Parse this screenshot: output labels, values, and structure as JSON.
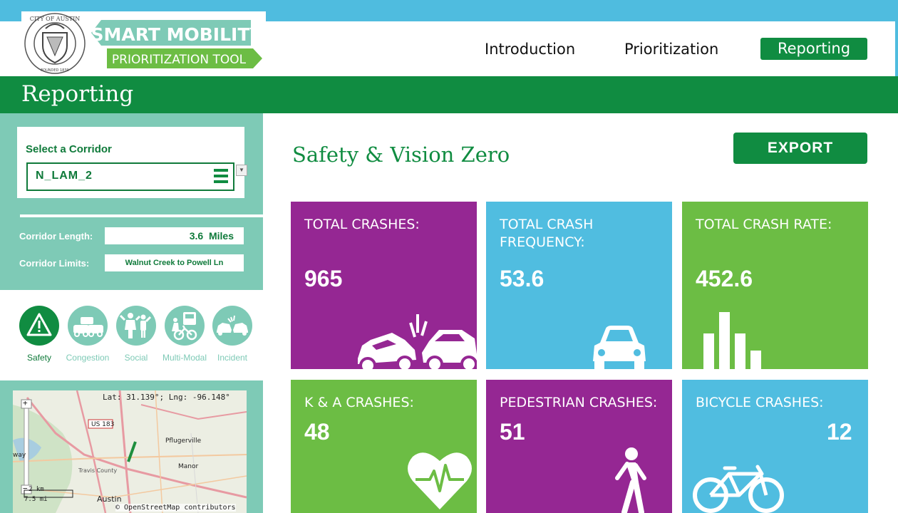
{
  "colors": {
    "brand_green": "#108c41",
    "mint": "#7ecab6",
    "purple": "#952793",
    "blue": "#50bde0",
    "lime": "#6cbd44",
    "top_blue": "#4fbcdf"
  },
  "logo": {
    "seal_text": "CITY OF AUSTIN",
    "seal_founded": "FOUNDED 1839",
    "line1": "SMART MOBILITY",
    "line2": "PRIORITIZATION TOOL"
  },
  "nav": {
    "items": [
      "Introduction",
      "Prioritization",
      "Reporting"
    ],
    "active": "Reporting"
  },
  "page": {
    "title": "Reporting"
  },
  "sidebar": {
    "select_label": "Select a Corridor",
    "selected_corridor": "N_LAM_2",
    "length_label": "Corridor Length:",
    "length_value": "3.6",
    "length_unit": "Miles",
    "limits_label": "Corridor Limits:",
    "limits_value": "Walnut Creek to Powell Ln",
    "categories": [
      {
        "label": "Safety",
        "icon": "warning-icon",
        "active": true
      },
      {
        "label": "Congestion",
        "icon": "traffic-cars-icon",
        "active": false
      },
      {
        "label": "Social",
        "icon": "people-icon",
        "active": false
      },
      {
        "label": "Multi-Modal",
        "icon": "bus-bike-icon",
        "active": false
      },
      {
        "label": "Incident",
        "icon": "car-crash-icon",
        "active": false
      }
    ]
  },
  "map": {
    "coords": "Lat: 31.139°; Lng: -96.148°",
    "labels": {
      "highway": "US 183",
      "pflugerville": "Pflugerville",
      "manor": "Manor",
      "travis": "Travis County",
      "austin": "Austin",
      "way": "way"
    },
    "scale_km": "2 km",
    "scale_mi": "7.5 mi",
    "attribution": "© OpenStreetMap contributors",
    "zoom_in": "+",
    "zoom_out": "−"
  },
  "main": {
    "section_title": "Safety & Vision Zero",
    "export_label": "EXPORT",
    "tiles": [
      {
        "title": "TOTAL CRASHES:",
        "value": "965",
        "icon": "car-crash-icon"
      },
      {
        "title": "TOTAL CRASH FREQUENCY:",
        "value": "53.6",
        "icon": "car-icon"
      },
      {
        "title": "TOTAL CRASH RATE:",
        "value": "452.6",
        "icon": "bar-chart-icon"
      },
      {
        "title": "K & A CRASHES:",
        "value": "48",
        "icon": "heartbeat-icon"
      },
      {
        "title": "PEDESTRIAN CRASHES:",
        "value": "51",
        "icon": "pedestrian-icon"
      },
      {
        "title": "BICYCLE CRASHES:",
        "value": "12",
        "icon": "bicycle-icon"
      }
    ]
  }
}
